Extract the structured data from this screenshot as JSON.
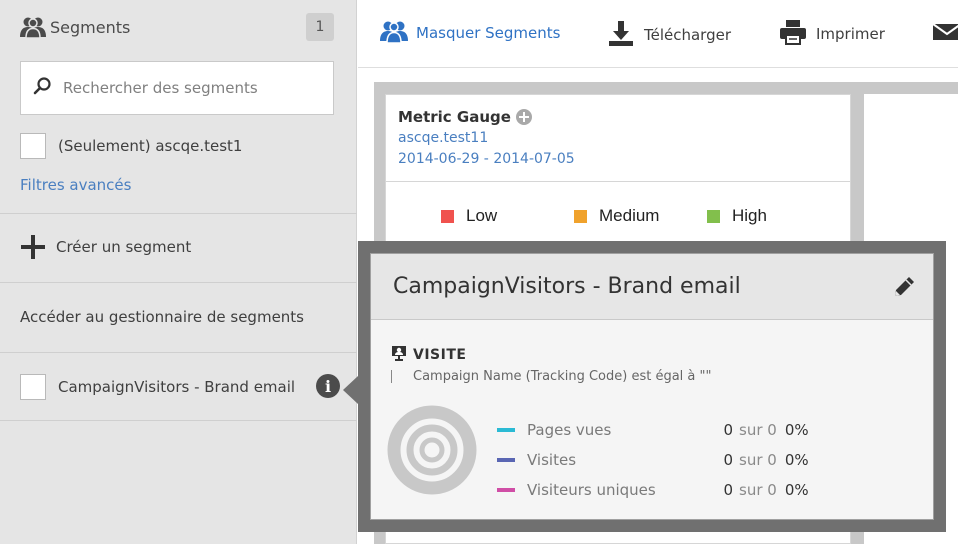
{
  "sidebar": {
    "title": "Segments",
    "count": "1",
    "search_placeholder": "Rechercher des segments",
    "option_label": "(Seulement) ascqe.test1",
    "advanced_filters": "Filtres avancés",
    "create_segment": "Créer un segment",
    "manager_link": "Accéder au gestionnaire de segments",
    "segment_item": "CampaignVisitors - Brand email",
    "info_icon_glyph": "i"
  },
  "toolbar": {
    "items": [
      {
        "label": "Masquer Segments",
        "icon": "users-icon"
      },
      {
        "label": "Télécharger",
        "icon": "download-icon"
      },
      {
        "label": "Imprimer",
        "icon": "print-icon"
      },
      {
        "label": "",
        "icon": "mail-icon"
      }
    ]
  },
  "report_card": {
    "title": "Metric Gauge",
    "suite": "ascqe.test11",
    "date_range": "2014-06-29 - 2014-07-05",
    "legend": [
      {
        "label": "Low",
        "color": "#f0524e"
      },
      {
        "label": "Medium",
        "color": "#f0a22c"
      },
      {
        "label": "High",
        "color": "#82bf4c"
      }
    ]
  },
  "popover": {
    "title": "CampaignVisitors - Brand email",
    "container_label": "VISITE",
    "rule": "Campaign Name (Tracking Code) est égal à \"\"",
    "metrics": [
      {
        "name": "Pages vues",
        "value": "0",
        "sur": "sur 0",
        "pct": "0%",
        "color": "#2bbad4"
      },
      {
        "name": "Visites",
        "value": "0",
        "sur": "sur 0",
        "pct": "0%",
        "color": "#5a66b3"
      },
      {
        "name": "Visiteurs uniques",
        "value": "0",
        "sur": "sur 0",
        "pct": "0%",
        "color": "#d04ea6"
      }
    ]
  }
}
